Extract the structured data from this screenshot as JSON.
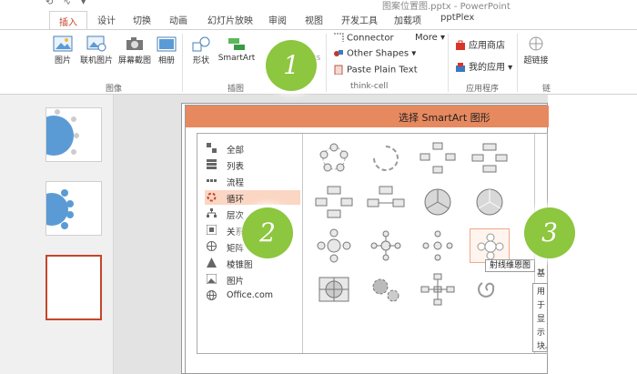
{
  "window": {
    "title": "图案位置图.pptx - PowerPoint",
    "qat": "⟲ ∿ ▾"
  },
  "tabs": [
    {
      "label": "插入",
      "active": true
    },
    {
      "label": "设计"
    },
    {
      "label": "切换"
    },
    {
      "label": "动画"
    },
    {
      "label": "幻灯片放映"
    },
    {
      "label": "审阅"
    },
    {
      "label": "视图"
    },
    {
      "label": "开发工具"
    },
    {
      "label": "加载项"
    },
    {
      "label": "pptPlex"
    }
  ],
  "ribbon": {
    "images": {
      "buttons": [
        "图片",
        "联机图片",
        "屏幕截图",
        "相册"
      ],
      "group_label": "图像"
    },
    "illustrations": {
      "buttons": [
        "形状",
        "SmartArt"
      ],
      "group_label": "插图",
      "partial": "ts"
    },
    "thinkcell": {
      "connector": "Connector",
      "other_shapes": "Other Shapes",
      "paste": "Paste Plain Text",
      "more": "More",
      "group_label": "think-cell"
    },
    "apps": {
      "store": "应用商店",
      "myapps": "我的应用",
      "group_label": "应用程序",
      "partial": "链"
    },
    "links": {
      "label": "超链接",
      "group_label": "链"
    }
  },
  "dialog": {
    "title": "选择 SmartArt 图形",
    "categories": [
      {
        "label": "全部"
      },
      {
        "label": "列表"
      },
      {
        "label": "流程"
      },
      {
        "label": "循环",
        "selected": true
      },
      {
        "label": "层次"
      },
      {
        "label": "关系"
      },
      {
        "label": "矩阵"
      },
      {
        "label": "棱锥图"
      },
      {
        "label": "图片"
      },
      {
        "label": "Office.com"
      }
    ],
    "tooltip": "射线维恩图",
    "basic_label": "基",
    "description": "用于显示块。间。"
  },
  "badges": [
    "1",
    "2",
    "3"
  ],
  "colors": {
    "accent": "#c6452a",
    "dialog_title": "#e7895f",
    "badge": "#8dc63f",
    "selection": "#fbd6c3"
  }
}
